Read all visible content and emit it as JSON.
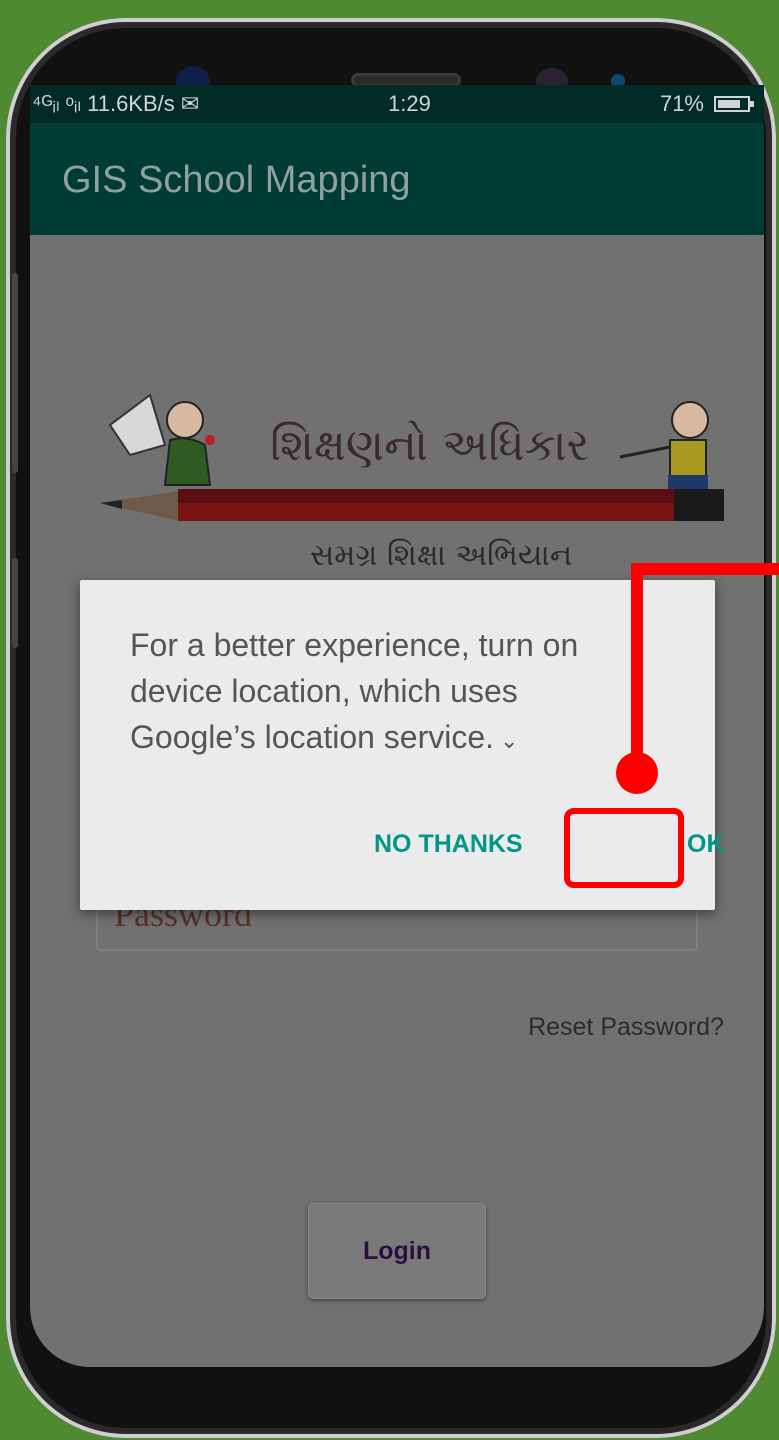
{
  "status_bar": {
    "signal_text": "⁴ᴳᵢₗ ᵒᵢₗ 11.6KB/s ✉",
    "time": "1:29",
    "battery": "71%"
  },
  "app_bar": {
    "title": "GIS School Mapping"
  },
  "logo": {
    "main_text": "શિક્ષણનો અધિકાર",
    "sub_text": "સમગ્ર શિક્ષા અભિયાન"
  },
  "form": {
    "password_placeholder": "Password",
    "reset_link": "Reset Password?",
    "login_label": "Login"
  },
  "dialog": {
    "message": "For a better experience, turn on device location, which uses Google’s location service.",
    "message_lines": [
      "For a better experience, turn on",
      "device location, which uses",
      "Google’s location service."
    ],
    "expand_icon": "chevron-down-icon",
    "no_thanks_label": "NO THANKS",
    "ok_label": "OK"
  },
  "colors": {
    "background": "#4f8a33",
    "app_bar": "#003c35",
    "status_bar": "#022a27",
    "dialog_button": "#009688",
    "highlight": "#ff0000"
  }
}
